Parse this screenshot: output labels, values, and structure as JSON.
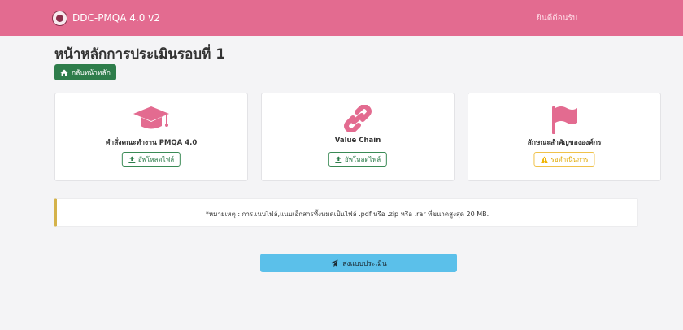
{
  "navbar": {
    "brand": "DDC-PMQA 4.0 v2",
    "welcome": "ยินดีต้อนรับ"
  },
  "page": {
    "title": "หน้าหลักการประเมินรอบที่ 1",
    "back_button": "กลับหน้าหลัก"
  },
  "cards": [
    {
      "label": "คำสั่งคณะทำงาน PMQA 4.0",
      "button": "อัพโหลดไฟล์",
      "icon": "graduation-cap-icon",
      "icon_color": "#e36b90"
    },
    {
      "label": "Value Chain",
      "button": "อัพโหลดไฟล์",
      "icon": "link-icon",
      "icon_color": "#e36b90"
    },
    {
      "label": "ลักษณะสำคัญขององค์กร",
      "button": "รอดำเนินการ",
      "icon": "flag-icon",
      "icon_color": "#e36b90"
    }
  ],
  "note": "*หมายเหตุ : การแนบไฟล์,แนบเอ็กสารทั้งหมดเป็นไฟล์ .pdf หรือ .zip หรือ .rar ที่ขนาดสูงสุด 20 MB.",
  "submit_button": "ส่งแบบประเมิน",
  "colors": {
    "navbar": "#e36b90",
    "back_button": "#2e7d4b",
    "submit_button": "#5bc0ea",
    "pending": "#e0a800",
    "note_accent": "#d4b24a"
  }
}
